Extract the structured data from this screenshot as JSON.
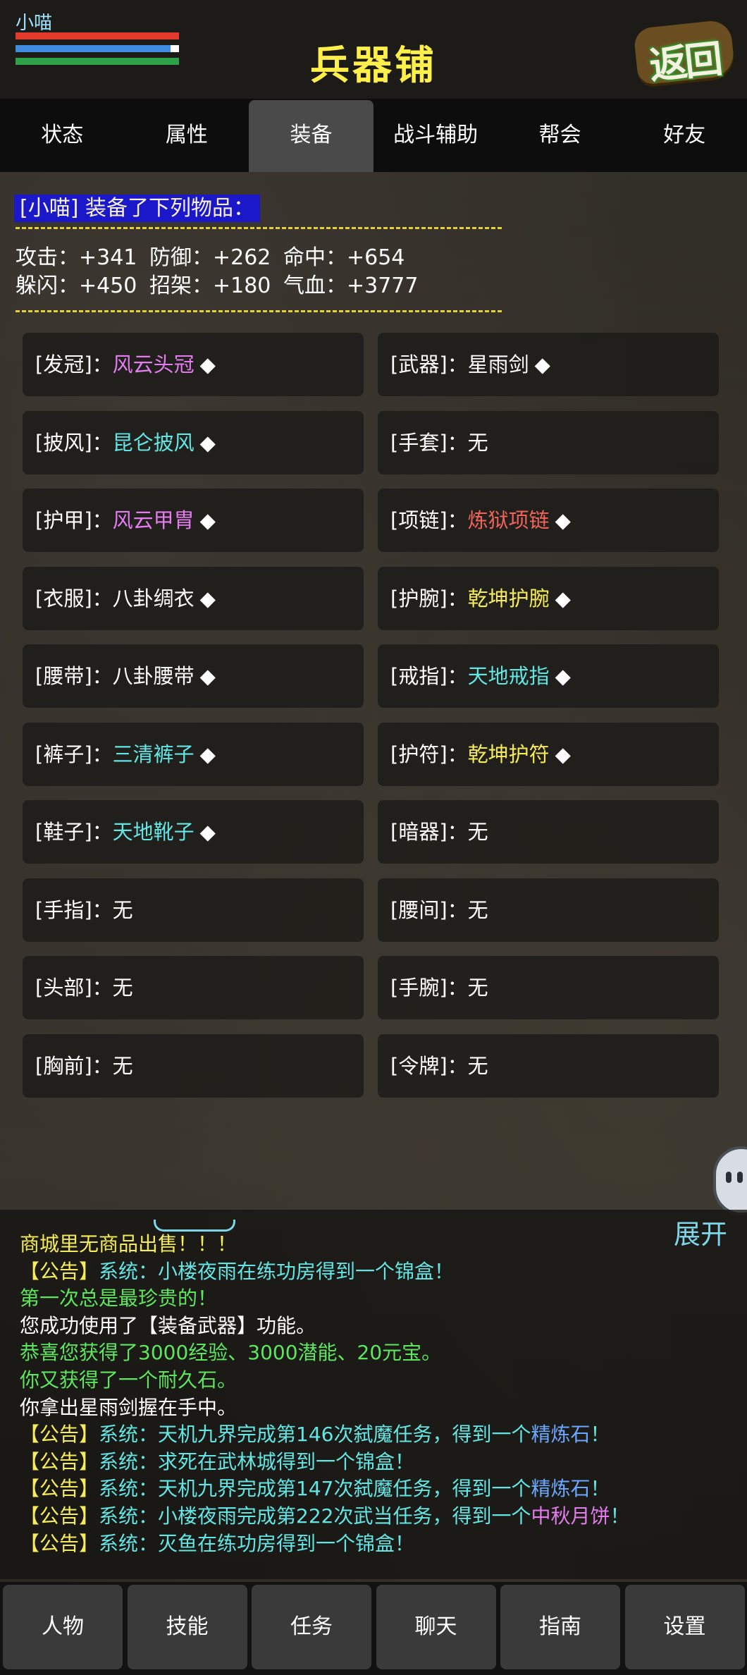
{
  "header": {
    "player_name": "小喵",
    "title": "兵器铺",
    "back_label": "返回"
  },
  "tabs": [
    {
      "label": "状态"
    },
    {
      "label": "属性"
    },
    {
      "label": "装备",
      "active": true
    },
    {
      "label": "战斗辅助"
    },
    {
      "label": "帮会"
    },
    {
      "label": "好友"
    }
  ],
  "equipment": {
    "heading": "[小喵] 装备了下列物品：",
    "stats": [
      [
        "攻击：+341",
        "防御：+262",
        "命中：+654"
      ],
      [
        "躲闪：+450",
        "招架：+180",
        "气血：+3777"
      ]
    ],
    "slots": [
      {
        "label": "[发冠]：",
        "item": "风云头冠",
        "marker": "◆",
        "color": "#e47cf0"
      },
      {
        "label": "[武器]：",
        "item": "星雨剑",
        "marker": "◆",
        "color": "#ffffff"
      },
      {
        "label": "[披风]：",
        "item": "昆仑披风",
        "marker": "◆",
        "color": "#63e5e3"
      },
      {
        "label": "[手套]：",
        "item": "无",
        "marker": "",
        "color": "#ffffff"
      },
      {
        "label": "[护甲]：",
        "item": "风云甲胄",
        "marker": "◆",
        "color": "#e47cf0"
      },
      {
        "label": "[项链]：",
        "item": "炼狱项链",
        "marker": "◆",
        "color": "#f0635a"
      },
      {
        "label": "[衣服]：",
        "item": "八卦绸衣",
        "marker": "◆",
        "color": "#ffffff"
      },
      {
        "label": "[护腕]：",
        "item": "乾坤护腕",
        "marker": "◆",
        "color": "#f6ec5a"
      },
      {
        "label": "[腰带]：",
        "item": "八卦腰带",
        "marker": "◆",
        "color": "#ffffff"
      },
      {
        "label": "[戒指]：",
        "item": "天地戒指",
        "marker": "◆",
        "color": "#63e5e3"
      },
      {
        "label": "[裤子]：",
        "item": "三清裤子",
        "marker": "◆",
        "color": "#63e5e3"
      },
      {
        "label": "[护符]：",
        "item": "乾坤护符",
        "marker": "◆",
        "color": "#f6ec5a"
      },
      {
        "label": "[鞋子]：",
        "item": "天地靴子",
        "marker": "◆",
        "color": "#63e5e3"
      },
      {
        "label": "[暗器]：",
        "item": "无",
        "marker": "",
        "color": "#ffffff"
      },
      {
        "label": "[手指]：",
        "item": "无",
        "marker": "",
        "color": "#ffffff"
      },
      {
        "label": "[腰间]：",
        "item": "无",
        "marker": "",
        "color": "#ffffff"
      },
      {
        "label": "[头部]：",
        "item": "无",
        "marker": "",
        "color": "#ffffff"
      },
      {
        "label": "[手腕]：",
        "item": "无",
        "marker": "",
        "color": "#ffffff"
      },
      {
        "label": "[胸前]：",
        "item": "无",
        "marker": "",
        "color": "#ffffff"
      },
      {
        "label": "[令牌]：",
        "item": "无",
        "marker": "",
        "color": "#ffffff"
      }
    ]
  },
  "log": {
    "expand_label": "展开",
    "lines": [
      [
        {
          "t": "商城里无商品出售！！！",
          "c": "y"
        }
      ],
      [
        {
          "t": "【公告】",
          "c": "y"
        },
        {
          "t": "系统：小楼夜雨在练功房得到一个锦盒！",
          "c": "cy"
        }
      ],
      [
        {
          "t": "第一次总是最珍贵的！",
          "c": "g"
        }
      ],
      [
        {
          "t": "您成功使用了【装备武器】功能。",
          "c": "w"
        }
      ],
      [
        {
          "t": "恭喜您获得了3000经验、3000潜能、20元宝。",
          "c": "g"
        }
      ],
      [
        {
          "t": "你又获得了一个耐久石。",
          "c": "g"
        }
      ],
      [
        {
          "t": "你拿出星雨剑握在手中。",
          "c": "w"
        }
      ],
      [
        {
          "t": "【公告】",
          "c": "y"
        },
        {
          "t": "系统：天机九界完成第146次弑魔任务，得到一个",
          "c": "cy"
        },
        {
          "t": "精炼石",
          "c": "bl"
        },
        {
          "t": "！",
          "c": "cy"
        }
      ],
      [
        {
          "t": "【公告】",
          "c": "y"
        },
        {
          "t": "系统：求死在武林城得到一个锦盒！",
          "c": "cy"
        }
      ],
      [
        {
          "t": "【公告】",
          "c": "y"
        },
        {
          "t": "系统：天机九界完成第147次弑魔任务，得到一个",
          "c": "cy"
        },
        {
          "t": "精炼石",
          "c": "bl"
        },
        {
          "t": "！",
          "c": "cy"
        }
      ],
      [
        {
          "t": "【公告】",
          "c": "y"
        },
        {
          "t": "系统：小楼夜雨完成第222次武当任务，得到一个",
          "c": "cy"
        },
        {
          "t": "中秋月饼",
          "c": "pk"
        },
        {
          "t": "！",
          "c": "cy"
        }
      ],
      [
        {
          "t": "【公告】",
          "c": "y"
        },
        {
          "t": "系统：灭鱼在练功房得到一个锦盒！",
          "c": "cy"
        }
      ]
    ]
  },
  "bottom_nav": [
    {
      "label": "人物"
    },
    {
      "label": "技能"
    },
    {
      "label": "任务"
    },
    {
      "label": "聊天"
    },
    {
      "label": "指南"
    },
    {
      "label": "设置"
    }
  ]
}
